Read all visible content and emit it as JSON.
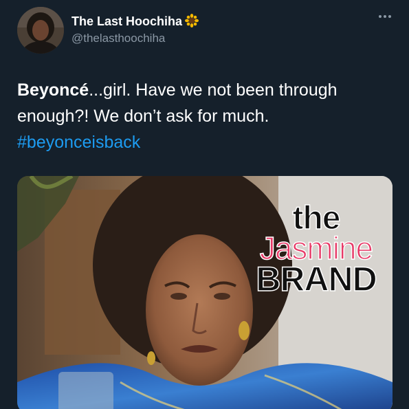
{
  "tweet": {
    "display_name": "The Last Hoochiha",
    "name_emoji": "sunflower-icon",
    "handle": "@thelasthoochiha",
    "text_bold": "Beyoncé",
    "text_rest": "...girl. Have we not been through enough?! We don’t ask for much.",
    "hashtag": "#beyonceisback"
  },
  "media": {
    "watermark": {
      "line1": "the",
      "line2": "Jasmine",
      "line3": "BRAND"
    }
  },
  "colors": {
    "background": "#15202b",
    "text": "#ffffff",
    "secondary_text": "#8b98a5",
    "link": "#1d9bf0",
    "watermark_pink": "#e73a67"
  }
}
